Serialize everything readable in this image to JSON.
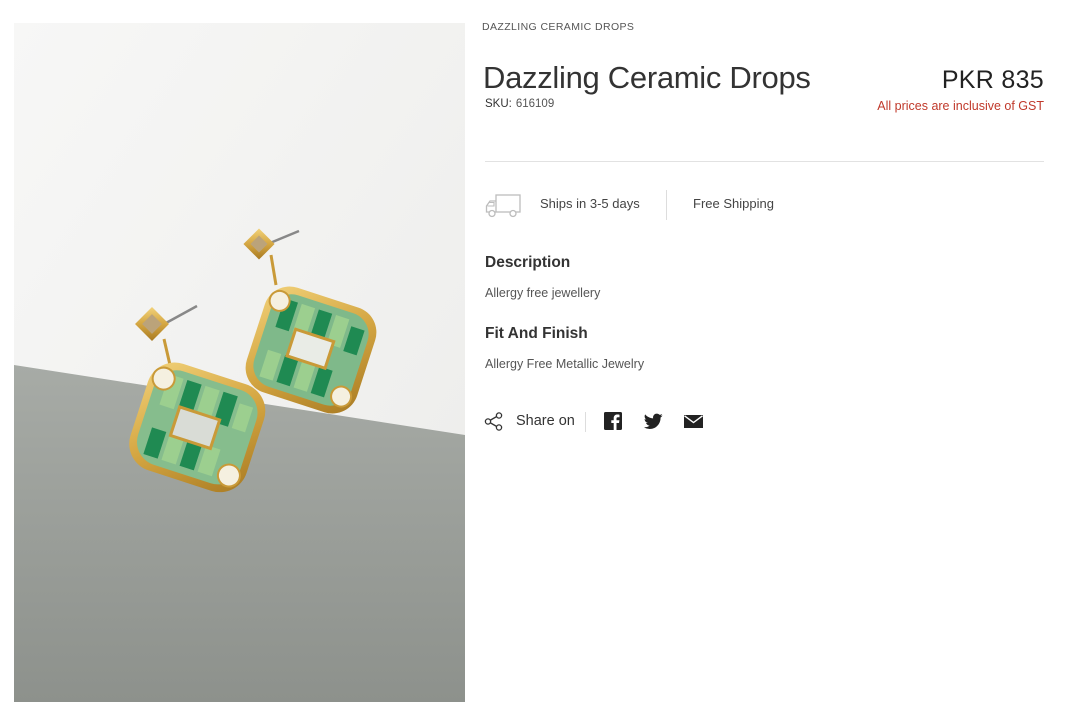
{
  "breadcrumb": "DAZZLING CERAMIC DROPS",
  "product": {
    "title": "Dazzling Ceramic Drops",
    "sku_label": "SKU:",
    "sku_value": "616109",
    "price": "PKR 835",
    "price_note": "All prices are inclusive of GST"
  },
  "shipping": {
    "ships_text": "Ships in 3-5 days",
    "free_text": "Free Shipping",
    "icon": "truck-icon"
  },
  "sections": {
    "description_title": "Description",
    "description_text": "Allergy free jewellery",
    "fit_title": "Fit And Finish",
    "fit_text": "Allergy Free Metallic Jewelry"
  },
  "share": {
    "label": "Share on",
    "icons": [
      "share-icon",
      "facebook-icon",
      "twitter-icon",
      "mail-icon"
    ]
  },
  "colors": {
    "accent_red": "#c0392b",
    "text_dark": "#333333",
    "divider": "#e2e2e2"
  }
}
